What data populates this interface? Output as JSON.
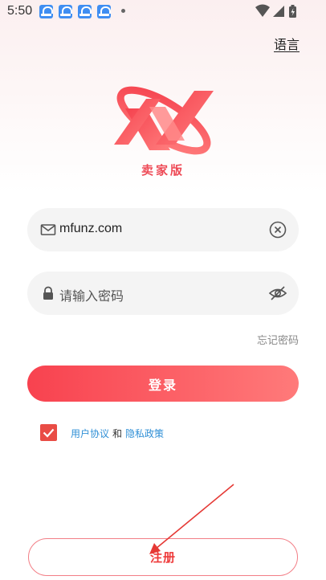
{
  "status_bar": {
    "time": "5:50",
    "notification_icons": [
      "baidu-cloud-icon",
      "baidu-cloud-icon",
      "baidu-cloud-icon",
      "baidu-cloud-icon"
    ],
    "system_icons": [
      "wifi-icon",
      "signal-icon",
      "battery-icon"
    ]
  },
  "header": {
    "language_link": "语言"
  },
  "logo": {
    "caption": "卖家版",
    "brand_color": "#ee4a56"
  },
  "form": {
    "email": {
      "value": "mfunz.com",
      "lead_icon": "mail-icon",
      "trail_icon": "clear-icon"
    },
    "password": {
      "placeholder": "请输入密码",
      "lead_icon": "lock-icon",
      "trail_icon": "eye-off-icon"
    },
    "forgot_password": "忘记密码",
    "login_button": "登录"
  },
  "agreement": {
    "checked": true,
    "user_agreement": "用户协议",
    "conjunction": "和",
    "privacy_policy": "隐私政策"
  },
  "register_button": "注册",
  "colors": {
    "accent": "#f8424f",
    "link": "#2f8fd6",
    "annotation": "#e53935"
  }
}
